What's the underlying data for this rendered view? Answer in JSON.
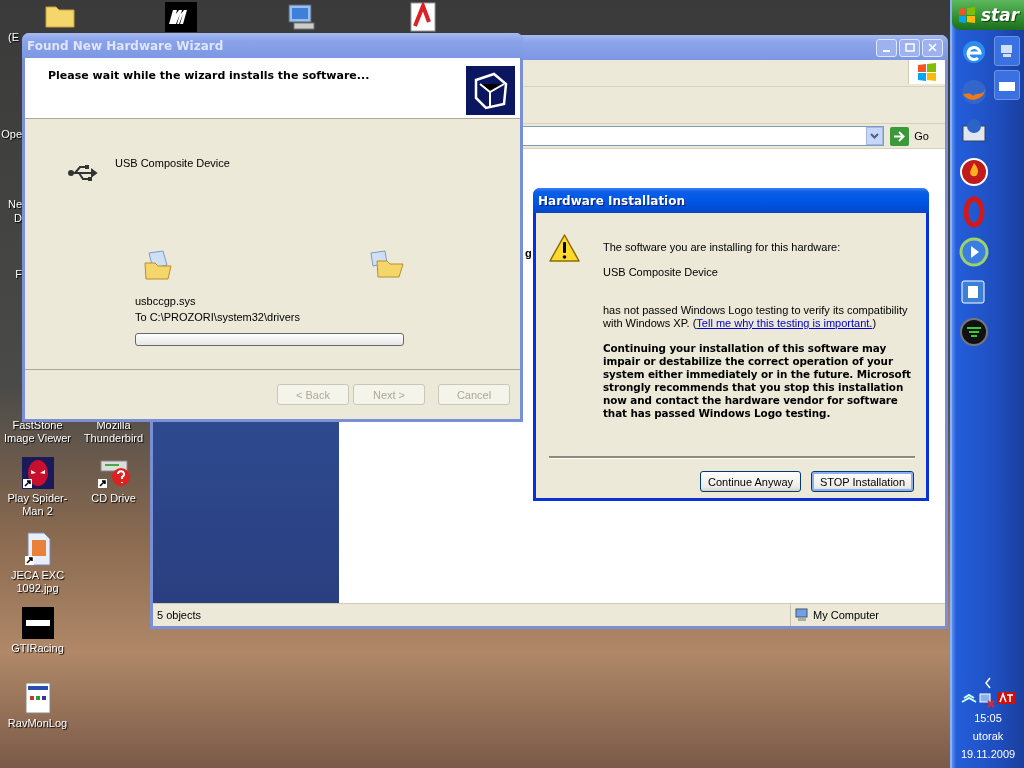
{
  "desktop": {
    "top_icons": [
      {
        "kind": "folder",
        "label": "(E"
      },
      {
        "kind": "mc"
      },
      {
        "kind": "computer"
      },
      {
        "kind": "pdf"
      }
    ],
    "cut_labels": [
      {
        "lines": [
          "Ope"
        ]
      },
      {
        "lines": [
          "Ne",
          "D"
        ]
      },
      {
        "lines": [
          "F"
        ]
      }
    ],
    "icon_columns": [
      [
        {
          "kind": "hidden",
          "label": "FastStone Image Viewer"
        },
        {
          "kind": "spider",
          "label": "Play Spider-Man 2"
        },
        {
          "kind": "image",
          "label": "JECA EXC 1092.jpg"
        },
        {
          "kind": "gti",
          "label": "GTIRacing"
        },
        {
          "kind": "log",
          "label": "RavMonLog"
        }
      ],
      [
        {
          "kind": "hidden",
          "label": "Mozilla Thunderbird"
        },
        {
          "kind": "cd",
          "label": "CD Drive"
        }
      ]
    ]
  },
  "explorer": {
    "go": "Go",
    "cut_text": "g",
    "status_left": "5 objects",
    "status_right": "My Computer"
  },
  "wizard": {
    "title": "Found New Hardware Wizard",
    "heading": "Please wait while the wizard installs the software...",
    "device": "USB Composite Device",
    "file": "usbccgp.sys",
    "destination": "To C:\\PROZORI\\system32\\drivers",
    "progress": {
      "level": 0
    },
    "buttons": [
      {
        "label": "< Back",
        "disabled": true
      },
      {
        "label": "Next >",
        "disabled": true
      },
      {
        "label": "Cancel",
        "disabled": true
      }
    ]
  },
  "hardware_dialog": {
    "title": "Hardware Installation",
    "intro": "The software you are installing for this hardware:",
    "device": "USB Composite Device",
    "notice": "has not passed Windows Logo testing to verify its compatibility with Windows XP. (",
    "link_end": ")",
    "link": "Tell me why this testing is important.",
    "warning": "Continuing your installation of this software may impair or destabilize the correct operation of your system either immediately or in the future. Microsoft strongly recommends that you stop this installation now and contact the hardware vendor for software that has passed Windows Logo testing.",
    "buttons": [
      {
        "label": "Continue Anyway",
        "default": false
      },
      {
        "label": "STOP Installation",
        "default": true
      }
    ]
  },
  "taskbar": {
    "start": "star",
    "time": "15:05",
    "day": "utorak",
    "date": "19.11.2009"
  }
}
